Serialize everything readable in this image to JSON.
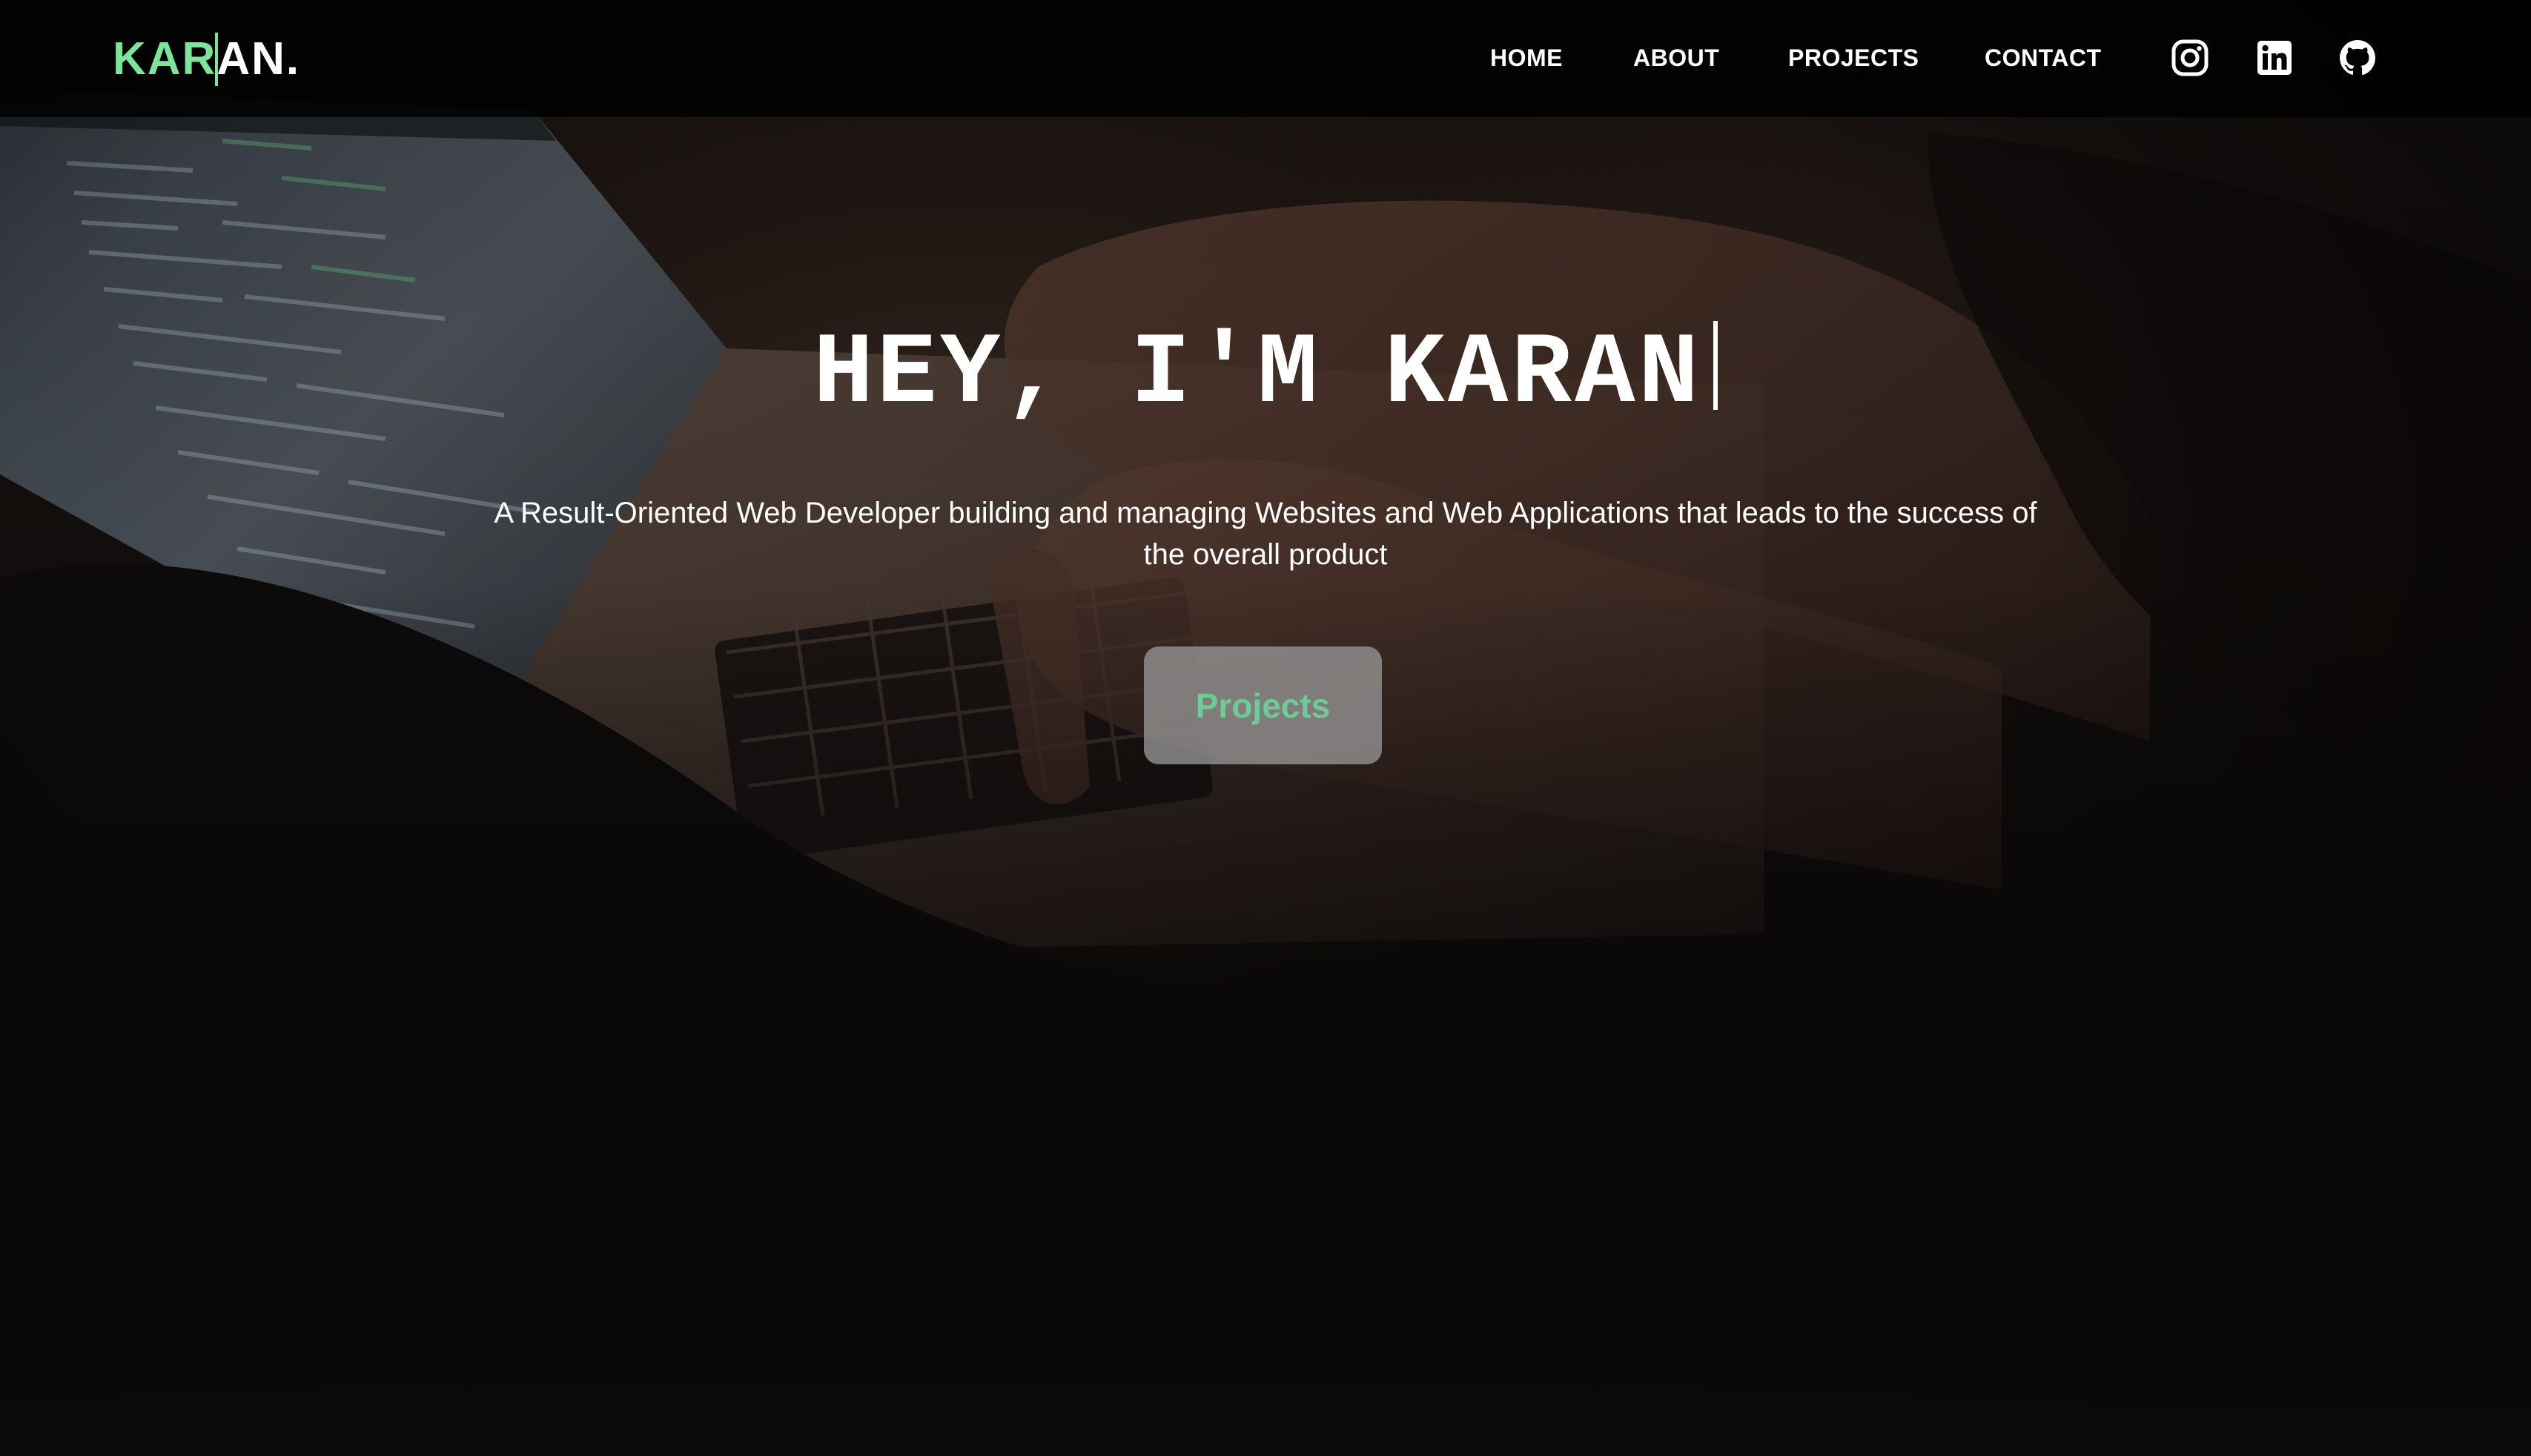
{
  "navbar": {
    "logo": {
      "part_green": "KAR",
      "part_white_a": "A",
      "part_white_rest": "N."
    },
    "links": [
      {
        "label": "HOME"
      },
      {
        "label": "ABOUT"
      },
      {
        "label": "PROJECTS"
      },
      {
        "label": "CONTACT"
      }
    ],
    "social": [
      {
        "icon": "instagram-icon"
      },
      {
        "icon": "linkedin-icon"
      },
      {
        "icon": "github-icon"
      }
    ]
  },
  "hero": {
    "title": "HEY, I'M KARAN",
    "subtitle": "A Result-Oriented Web Developer building and managing Websites and Web Applications that leads to the success of the overall product",
    "cta_label": "Projects"
  },
  "colors": {
    "accent": "#7ee39c",
    "button_text": "#6fca97",
    "background": "#0b090a",
    "nav_bg": "#000000"
  }
}
